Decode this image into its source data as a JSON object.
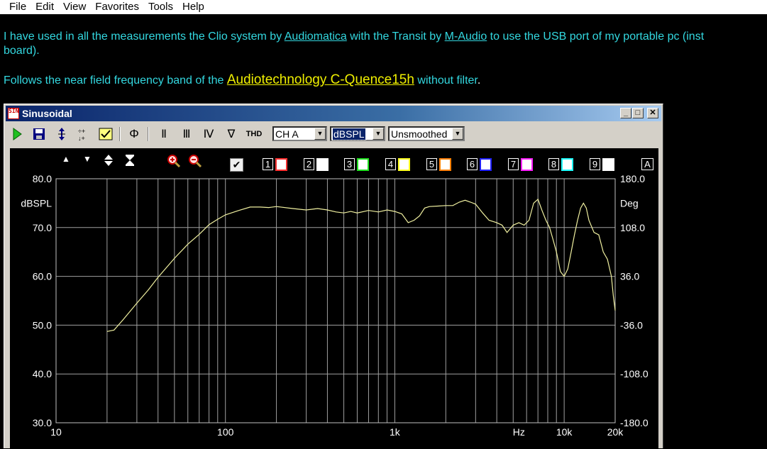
{
  "menu": [
    "File",
    "Edit",
    "View",
    "Favorites",
    "Tools",
    "Help"
  ],
  "paragraph1": {
    "part1": "I have used in all the measurements the Clio system by ",
    "link1": "Audiomatica",
    "part2": " with the Transit by ",
    "link2": "M-Audio",
    "part3": " to use the USB port of my portable pc (inst",
    "line2": "board)."
  },
  "paragraph2": {
    "part1": "Follows the near field frequency band of the ",
    "link": "Audiotechnology  C-Quence15h",
    "part2": " without filter",
    "end": "."
  },
  "window": {
    "title": "Sinusoidal",
    "icon_text": "SIN",
    "caption_buttons": [
      "_",
      "□",
      "✕"
    ],
    "toolbar": {
      "play_icon": "play-icon",
      "save_icon": "save-icon",
      "buttons": [
        "Φ",
        "Ⅱ",
        "Ⅲ",
        "Ⅳ",
        "∇",
        "THD"
      ],
      "channel": "CH A",
      "unit": "dBSPL",
      "smoothing": "Unsmoothed"
    },
    "controls": {
      "arrows": [
        "▲",
        "▼",
        "⬍",
        "⧗"
      ],
      "overlay_numbers": [
        "1",
        "2",
        "3",
        "4",
        "5",
        "6",
        "7",
        "8",
        "9"
      ],
      "overlay_colors": [
        "#ff3030",
        "#ffffff",
        "#20e020",
        "#ffff20",
        "#ff8000",
        "#2020ff",
        "#ff20ff",
        "#20ffff",
        "#ffffff"
      ],
      "auto_label": "A"
    }
  },
  "chart_data": {
    "type": "line",
    "title": "",
    "xlabel": "Hz",
    "ylabel": "dBSPL",
    "y2label": "Deg",
    "x_scale": "log",
    "xlim": [
      10,
      20000
    ],
    "ylim": [
      30,
      80
    ],
    "y2lim": [
      -180,
      180
    ],
    "x_ticks": [
      "10",
      "100",
      "1k",
      "10k",
      "20k"
    ],
    "y_ticks": [
      "80.0",
      "70.0",
      "60.0",
      "50.0",
      "40.0",
      "30.0"
    ],
    "y2_ticks": [
      "180.0",
      "108.0",
      "36.0",
      "-36.0",
      "-108.0",
      "-180.0"
    ],
    "grid": true,
    "line_color": "#f0f0a0",
    "series": [
      {
        "points": [
          [
            20,
            48.7
          ],
          [
            22,
            49.0
          ],
          [
            25,
            51.2
          ],
          [
            30,
            54.5
          ],
          [
            35,
            57.2
          ],
          [
            40,
            59.8
          ],
          [
            50,
            63.7
          ],
          [
            60,
            66.6
          ],
          [
            70,
            68.6
          ],
          [
            80,
            70.6
          ],
          [
            90,
            71.7
          ],
          [
            100,
            72.6
          ],
          [
            120,
            73.5
          ],
          [
            140,
            74.2
          ],
          [
            160,
            74.2
          ],
          [
            180,
            74.1
          ],
          [
            200,
            74.3
          ],
          [
            250,
            73.9
          ],
          [
            300,
            73.6
          ],
          [
            350,
            73.9
          ],
          [
            400,
            73.6
          ],
          [
            450,
            73.2
          ],
          [
            500,
            73.0
          ],
          [
            550,
            73.3
          ],
          [
            600,
            73.0
          ],
          [
            700,
            73.5
          ],
          [
            800,
            73.2
          ],
          [
            900,
            73.6
          ],
          [
            1000,
            73.3
          ],
          [
            1100,
            72.8
          ],
          [
            1200,
            71.0
          ],
          [
            1300,
            71.5
          ],
          [
            1400,
            72.4
          ],
          [
            1500,
            74.0
          ],
          [
            1600,
            74.3
          ],
          [
            1800,
            74.4
          ],
          [
            2000,
            74.5
          ],
          [
            2200,
            74.5
          ],
          [
            2400,
            75.2
          ],
          [
            2600,
            75.6
          ],
          [
            2800,
            75.2
          ],
          [
            3000,
            74.8
          ],
          [
            3300,
            73.0
          ],
          [
            3600,
            71.5
          ],
          [
            4000,
            71.0
          ],
          [
            4300,
            70.5
          ],
          [
            4600,
            69.0
          ],
          [
            5000,
            70.5
          ],
          [
            5400,
            71.0
          ],
          [
            5800,
            70.5
          ],
          [
            6200,
            71.5
          ],
          [
            6600,
            75.0
          ],
          [
            7000,
            75.8
          ],
          [
            7400,
            73.5
          ],
          [
            7800,
            71.5
          ],
          [
            8200,
            70.0
          ],
          [
            8600,
            67.5
          ],
          [
            9000,
            65.0
          ],
          [
            9500,
            61.0
          ],
          [
            10000,
            60.0
          ],
          [
            10500,
            61.5
          ],
          [
            11000,
            65.0
          ],
          [
            11500,
            68.5
          ],
          [
            12000,
            71.5
          ],
          [
            12500,
            74.0
          ],
          [
            13000,
            75.0
          ],
          [
            13500,
            74.0
          ],
          [
            14000,
            71.5
          ],
          [
            15000,
            69.0
          ],
          [
            16000,
            68.5
          ],
          [
            17000,
            65.0
          ],
          [
            18000,
            63.5
          ],
          [
            19000,
            60.0
          ],
          [
            19500,
            56.0
          ],
          [
            20000,
            53.0
          ]
        ]
      }
    ]
  }
}
